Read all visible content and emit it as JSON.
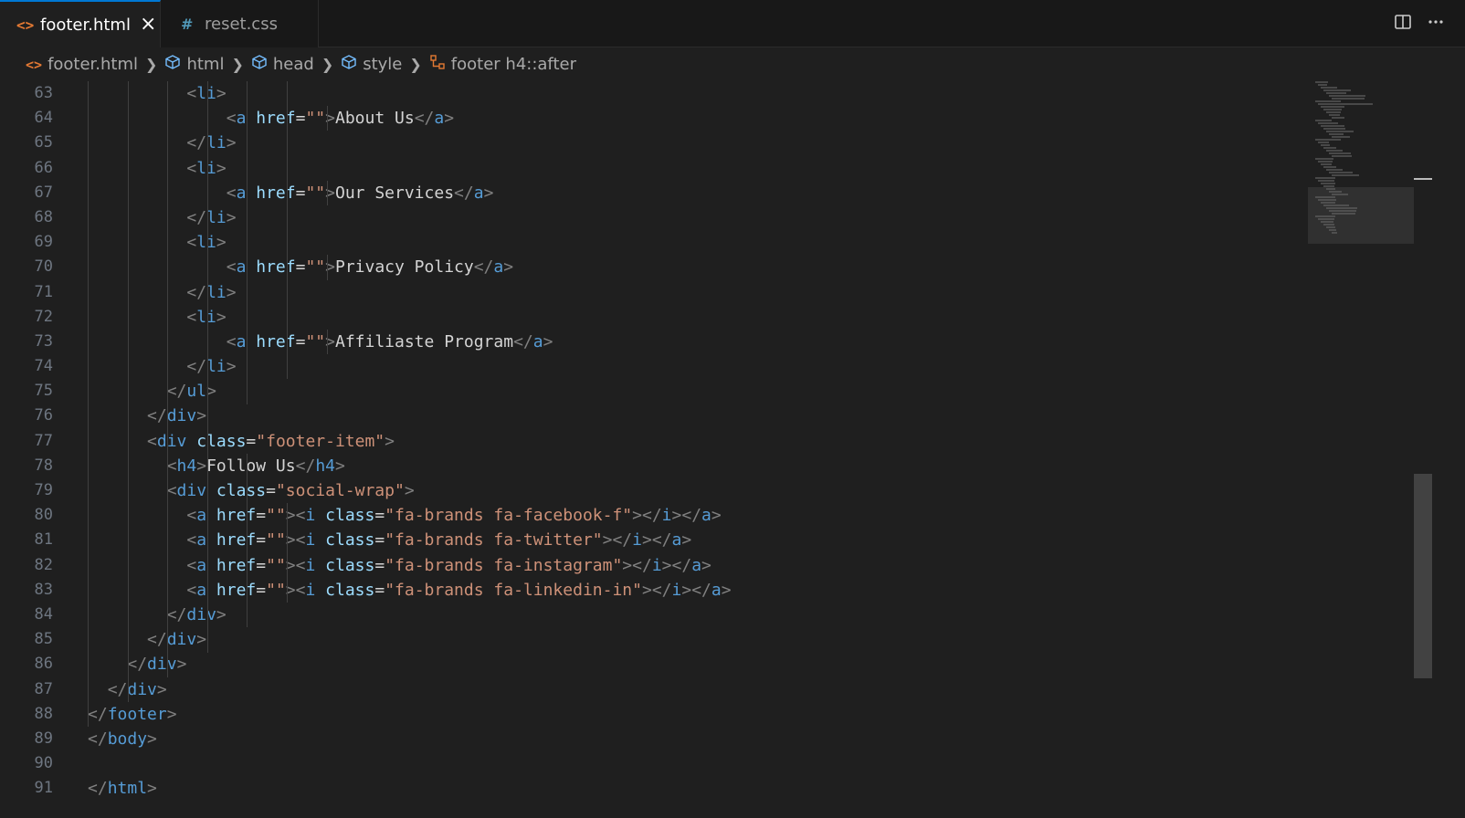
{
  "tabs": [
    {
      "label": "footer.html",
      "icon": "html-file-icon",
      "active": true
    },
    {
      "label": "reset.css",
      "icon": "css-hash-icon",
      "active": false
    }
  ],
  "tab_icons": {
    "html": "<>",
    "css": "#",
    "close": "×"
  },
  "toolbar_icons": {
    "split": "split-editor-icon",
    "more": "more-actions-icon"
  },
  "breadcrumb": [
    {
      "label": "footer.html",
      "icon": "html-file-icon"
    },
    {
      "label": "html",
      "icon": "cube-icon"
    },
    {
      "label": "head",
      "icon": "cube-icon"
    },
    {
      "label": "style",
      "icon": "cube-icon"
    },
    {
      "label": "footer h4::after",
      "icon": "selector-icon"
    }
  ],
  "line_numbers": [
    "63",
    "64",
    "65",
    "66",
    "67",
    "68",
    "69",
    "70",
    "71",
    "72",
    "73",
    "74",
    "75",
    "76",
    "77",
    "78",
    "79",
    "80",
    "81",
    "82",
    "83",
    "84",
    "85",
    "86",
    "87",
    "88",
    "89",
    "90",
    "91"
  ],
  "code": {
    "l63": {
      "o": "<",
      "t": "li",
      "c": ">"
    },
    "l64": {
      "o": "<",
      "t": "a",
      "attr": "href",
      "eq": "=",
      "v": "\"\"",
      "c": ">",
      "text": "About Us",
      "o2": "</",
      "t2": "a",
      "c2": ">"
    },
    "l65": {
      "o": "</",
      "t": "li",
      "c": ">"
    },
    "l66": {
      "o": "<",
      "t": "li",
      "c": ">"
    },
    "l67": {
      "o": "<",
      "t": "a",
      "attr": "href",
      "eq": "=",
      "v": "\"\"",
      "c": ">",
      "text": "Our Services",
      "o2": "</",
      "t2": "a",
      "c2": ">"
    },
    "l68": {
      "o": "</",
      "t": "li",
      "c": ">"
    },
    "l69": {
      "o": "<",
      "t": "li",
      "c": ">"
    },
    "l70": {
      "o": "<",
      "t": "a",
      "attr": "href",
      "eq": "=",
      "v": "\"\"",
      "c": ">",
      "text": "Privacy Policy",
      "o2": "</",
      "t2": "a",
      "c2": ">"
    },
    "l71": {
      "o": "</",
      "t": "li",
      "c": ">"
    },
    "l72": {
      "o": "<",
      "t": "li",
      "c": ">"
    },
    "l73": {
      "o": "<",
      "t": "a",
      "attr": "href",
      "eq": "=",
      "v": "\"\"",
      "c": ">",
      "text": "Affiliaste Program",
      "o2": "</",
      "t2": "a",
      "c2": ">"
    },
    "l74": {
      "o": "</",
      "t": "li",
      "c": ">"
    },
    "l75": {
      "o": "</",
      "t": "ul",
      "c": ">"
    },
    "l76": {
      "o": "</",
      "t": "div",
      "c": ">"
    },
    "l77": {
      "o": "<",
      "t": "div",
      "attr": "class",
      "eq": "=",
      "v": "\"footer-item\"",
      "c": ">"
    },
    "l78": {
      "o": "<",
      "t": "h4",
      "c": ">",
      "text": "Follow Us",
      "o2": "</",
      "t2": "h4",
      "c2": ">"
    },
    "l79": {
      "o": "<",
      "t": "div",
      "attr": "class",
      "eq": "=",
      "v": "\"social-wrap\"",
      "c": ">"
    },
    "l80": {
      "o": "<",
      "t": "a",
      "attr": "href",
      "eq": "=",
      "v": "\"\"",
      "c": ">",
      "o2": "<",
      "t2": "i",
      "attr2": "class",
      "eq2": "=",
      "v2": "\"fa-brands fa-facebook-f\"",
      "c2": ">",
      "o3": "</",
      "t3": "i",
      "c3": ">",
      "o4": "</",
      "t4": "a",
      "c4": ">"
    },
    "l81": {
      "o": "<",
      "t": "a",
      "attr": "href",
      "eq": "=",
      "v": "\"\"",
      "c": ">",
      "o2": "<",
      "t2": "i",
      "attr2": "class",
      "eq2": "=",
      "v2": "\"fa-brands fa-twitter\"",
      "c2": ">",
      "o3": "</",
      "t3": "i",
      "c3": ">",
      "o4": "</",
      "t4": "a",
      "c4": ">"
    },
    "l82": {
      "o": "<",
      "t": "a",
      "attr": "href",
      "eq": "=",
      "v": "\"\"",
      "c": ">",
      "o2": "<",
      "t2": "i",
      "attr2": "class",
      "eq2": "=",
      "v2": "\"fa-brands fa-instagram\"",
      "c2": ">",
      "o3": "</",
      "t3": "i",
      "c3": ">",
      "o4": "</",
      "t4": "a",
      "c4": ">"
    },
    "l83": {
      "o": "<",
      "t": "a",
      "attr": "href",
      "eq": "=",
      "v": "\"\"",
      "c": ">",
      "o2": "<",
      "t2": "i",
      "attr2": "class",
      "eq2": "=",
      "v2": "\"fa-brands fa-linkedin-in\"",
      "c2": ">",
      "o3": "</",
      "t3": "i",
      "c3": ">",
      "o4": "</",
      "t4": "a",
      "c4": ">"
    },
    "l84": {
      "o": "</",
      "t": "div",
      "c": ">"
    },
    "l85": {
      "o": "</",
      "t": "div",
      "c": ">"
    },
    "l86": {
      "o": "</",
      "t": "div",
      "c": ">"
    },
    "l87": {
      "o": "</",
      "t": "div",
      "c": ">"
    },
    "l88": {
      "o": "</",
      "t": "footer",
      "c": ">"
    },
    "l89": {
      "o": "</",
      "t": "body",
      "c": ">"
    },
    "l91": {
      "o": "</",
      "t": "html",
      "c": ">"
    }
  },
  "colors": {
    "tag": "#569cd6",
    "attr": "#9cdcfe",
    "string": "#ce9178",
    "punct": "#808080",
    "accent": "#0078d4"
  }
}
